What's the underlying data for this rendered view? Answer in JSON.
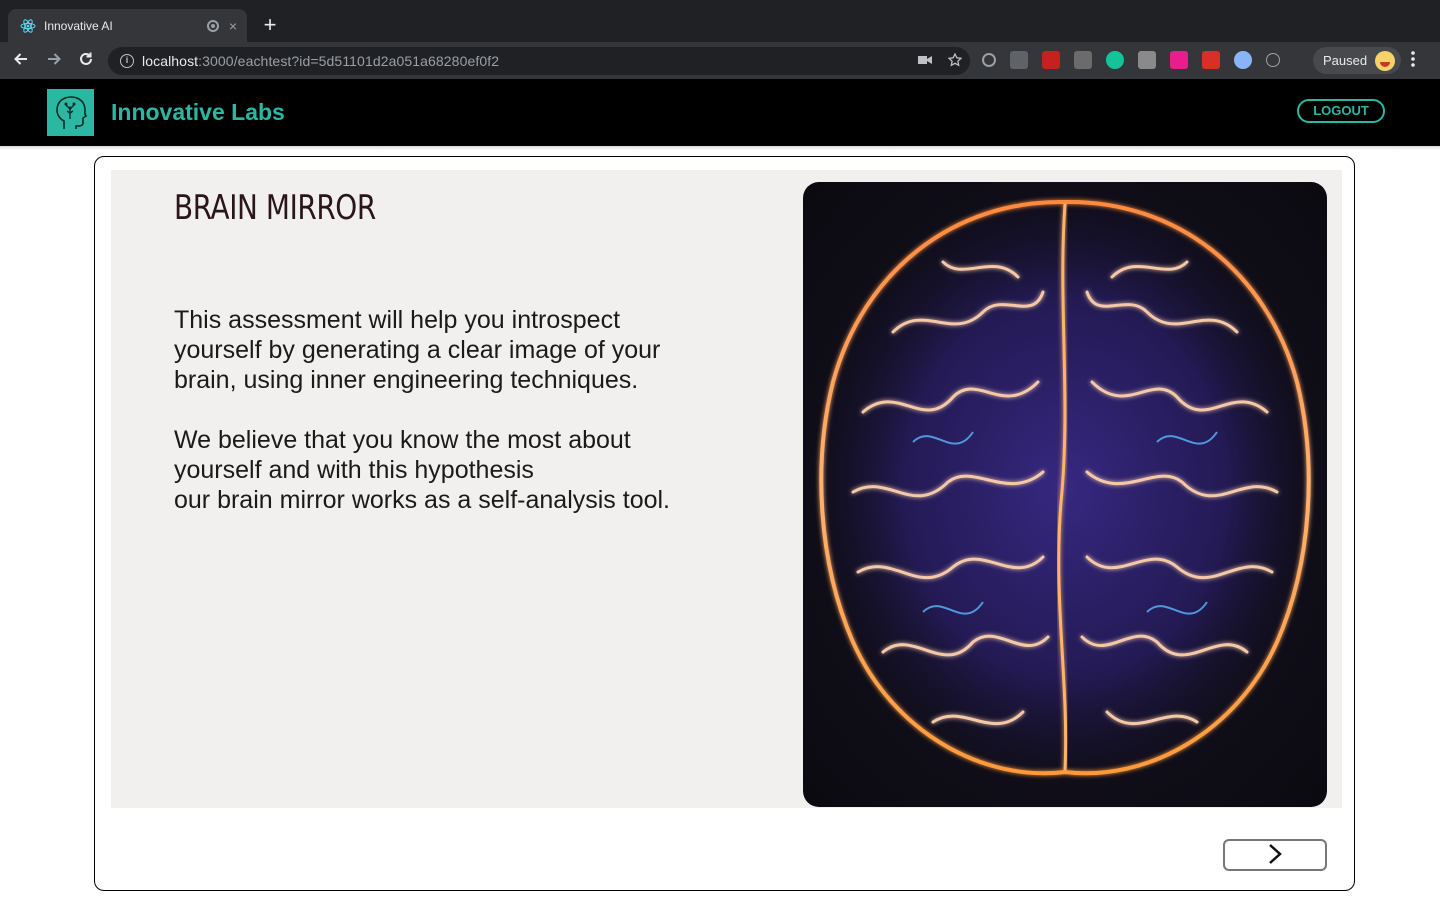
{
  "browser": {
    "tab_title": "Innovative AI",
    "tab_close": "×",
    "new_tab": "+",
    "url_host": "localhost",
    "url_path": ":3000/eachtest?id=5d51101d2a051a68280ef0f2",
    "profile_label": "Paused",
    "icons": [
      "back-arrow-icon",
      "forward-arrow-icon",
      "reload-icon",
      "info-icon",
      "camera-icon",
      "star-icon",
      "kebab-menu-icon"
    ]
  },
  "header": {
    "brand": "Innovative Labs",
    "logout_label": "LOGOUT",
    "accent_color": "#2bb8a3"
  },
  "content": {
    "title": "BRAIN MIRROR",
    "paragraph1": [
      "This assessment will help you introspect",
      "yourself by generating a clear image of your",
      "brain, using inner engineering techniques."
    ],
    "paragraph2": [
      "We believe that you know the most about",
      "yourself and with this hypothesis",
      "our brain mirror works as a self-analysis tool."
    ],
    "next_icon": "chevron-right-icon"
  }
}
